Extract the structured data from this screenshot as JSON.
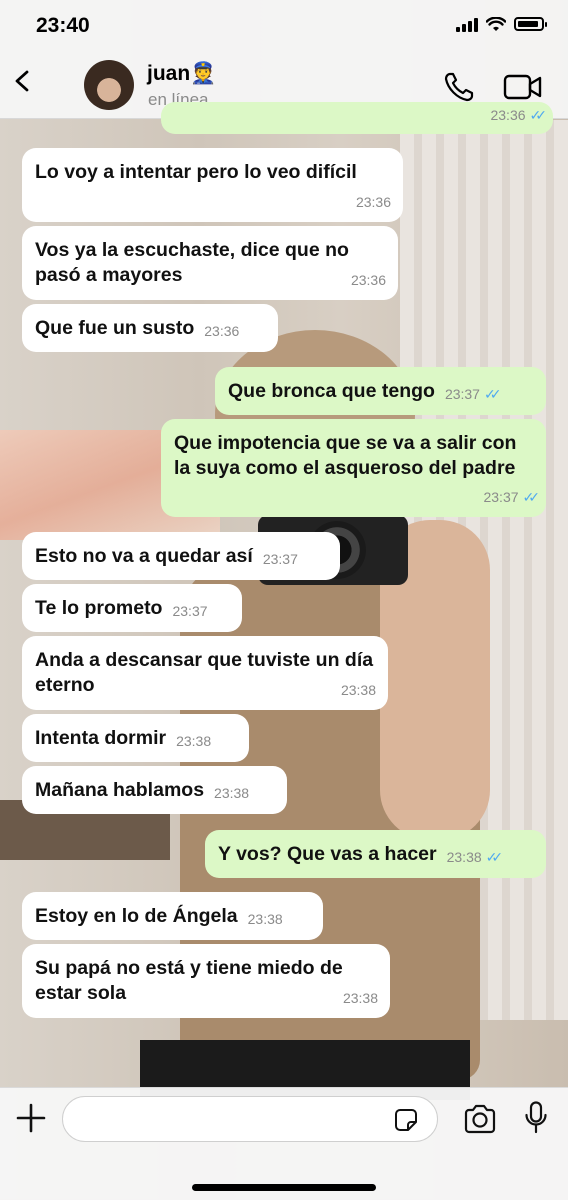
{
  "status_bar": {
    "time": "23:40"
  },
  "header": {
    "contact_name": "juan👮",
    "contact_status": "en línea"
  },
  "messages": [
    {
      "direction": "out",
      "text": "",
      "time": "23:36",
      "read": true
    },
    {
      "direction": "in",
      "text": "Lo voy a intentar pero lo veo difícil",
      "time": "23:36"
    },
    {
      "direction": "in",
      "text": "Vos ya la escuchaste, dice que no pasó a mayores",
      "time": "23:36"
    },
    {
      "direction": "in",
      "text": "Que fue un susto",
      "time": "23:36"
    },
    {
      "direction": "out",
      "text": "Que bronca que tengo",
      "time": "23:37",
      "read": true
    },
    {
      "direction": "out",
      "text": "Que impotencia que se va a salir con la suya como el asqueroso del padre",
      "time": "23:37",
      "read": true
    },
    {
      "direction": "in",
      "text": "Esto no va a quedar así",
      "time": "23:37"
    },
    {
      "direction": "in",
      "text": "Te lo prometo",
      "time": "23:37"
    },
    {
      "direction": "in",
      "text": "Anda a descansar que tuviste un día eterno",
      "time": "23:38"
    },
    {
      "direction": "in",
      "text": "Intenta dormir",
      "time": "23:38"
    },
    {
      "direction": "in",
      "text": "Mañana hablamos",
      "time": "23:38"
    },
    {
      "direction": "out",
      "text": "Y vos? Que vas a hacer",
      "time": "23:38",
      "read": true
    },
    {
      "direction": "in",
      "text": "Estoy en lo de Ángela",
      "time": "23:38"
    },
    {
      "direction": "in",
      "text": "Su papá no está y tiene miedo de estar sola",
      "time": "23:38"
    }
  ],
  "composer": {
    "value": "",
    "placeholder": ""
  },
  "icons": {
    "back": "chevron-left-icon",
    "call": "phone-icon",
    "video": "video-camera-icon",
    "attach": "plus-icon",
    "sticker": "sticker-icon",
    "camera": "camera-icon",
    "mic": "microphone-icon"
  },
  "colors": {
    "incoming_bubble": "#ffffff",
    "outgoing_bubble": "#dcf8c6",
    "read_ticks": "#4fa9f0"
  }
}
